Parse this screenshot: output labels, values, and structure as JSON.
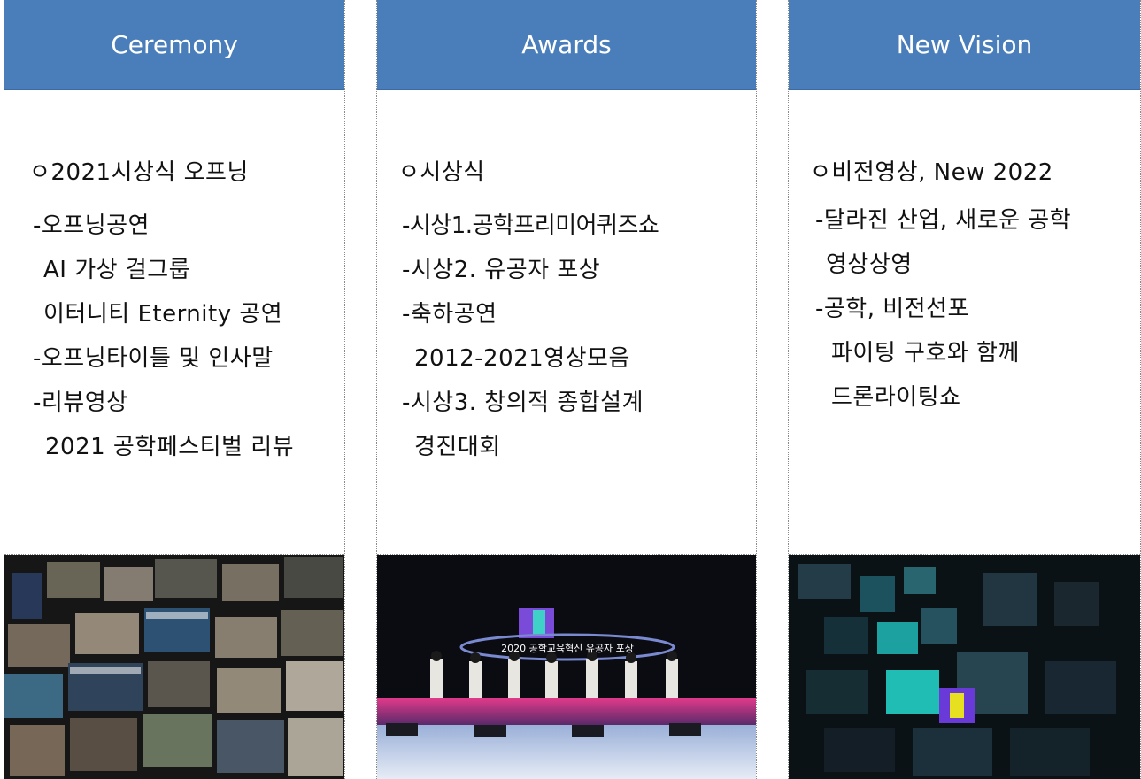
{
  "columns": [
    {
      "header": "Ceremony",
      "lines": [
        "ㅇ2021시상식 오프닝",
        "-오프닝공연",
        "AI 가상 걸그룹",
        "이터니티 Eternity 공연",
        "-오프닝타이틀 및 인사말",
        "-리뷰영상",
        "2021 공학페스티벌 리뷰"
      ],
      "photo": "ceremony-collage-photo"
    },
    {
      "header": "Awards",
      "lines": [
        "ㅇ시상식",
        "-시상1.공학프리미어퀴즈쇼",
        "-시상2. 유공자 포상",
        "-축하공연",
        "2012-2021영상모음",
        "-시상3. 창의적 종합설계",
        "경진대회"
      ],
      "photo_banner": "2020 공학교육혁신 유공자 포상"
    },
    {
      "header": "New Vision",
      "lines": [
        "ㅇ비전영상, New 2022",
        "-달라진 산업, 새로운 공학",
        "영상상영",
        "-공학, 비전선포",
        "파이팅 구호와 함께",
        "드론라이팅쇼"
      ],
      "photo": "circuit-vision-photo"
    }
  ],
  "colors": {
    "header_bg": "#4a7ebb",
    "header_text": "#ffffff",
    "border": "#8a8a8a"
  }
}
